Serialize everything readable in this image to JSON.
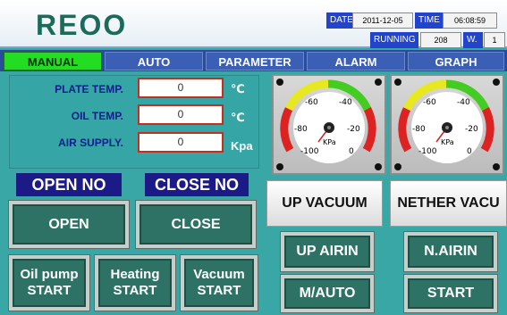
{
  "header": {
    "logo": "REOO",
    "date_label": "DATE",
    "date_value": "2011-12-05",
    "time_label": "TIME",
    "time_value": "06:08:59",
    "running_label": "RUNNING",
    "running_value": "208",
    "w_label": "W.",
    "w_value": "1"
  },
  "tabs": [
    "MANUAL",
    "AUTO",
    "PARAMETER",
    "ALARM",
    "GRAPH"
  ],
  "fields": [
    {
      "label": "PLATE TEMP.",
      "value": "0",
      "unit": "℃"
    },
    {
      "label": "OIL TEMP.",
      "value": "0",
      "unit": "℃"
    },
    {
      "label": "AIR SUPPLY.",
      "value": "0",
      "unit": "Kpa"
    }
  ],
  "gauges": [
    {
      "unit": "KPa",
      "ticks": [
        "-100",
        "-80",
        "-60",
        "-40",
        "-20",
        "0"
      ],
      "value": -100
    },
    {
      "unit": "KPa",
      "ticks": [
        "-100",
        "-80",
        "-60",
        "-40",
        "-20",
        "0"
      ],
      "value": -100
    }
  ],
  "status": {
    "open": "OPEN NO",
    "close": "CLOSE NO"
  },
  "buttons": {
    "open": "OPEN",
    "close": "CLOSE",
    "oil_pump_1": "Oil pump",
    "oil_pump_2": "START",
    "heating_1": "Heating",
    "heating_2": "START",
    "vacuum_1": "Vacuum",
    "vacuum_2": "START",
    "up_vacuum": "UP VACUUM",
    "nether_vacuum": "NETHER VACU",
    "up_airin": "UP AIRIN",
    "n_airin": "N.AIRIN",
    "m_auto": "M/AUTO",
    "start": "START"
  },
  "colors": {
    "accent_green": "#22dd22",
    "panel_teal": "#3aa7a7",
    "tab_blue": "#3b5fb5",
    "button_green": "#2e7266"
  }
}
